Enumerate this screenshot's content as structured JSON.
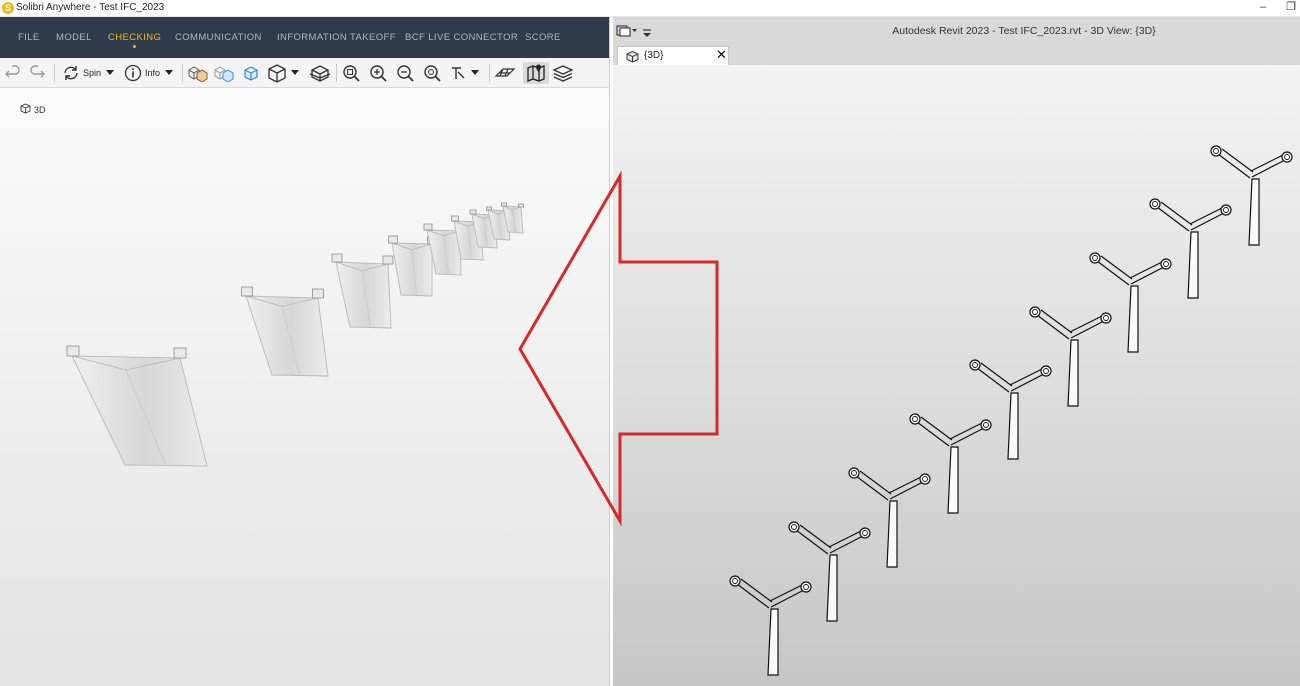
{
  "solibri": {
    "window_title": "Solibri Anywhere - Test IFC_2023",
    "logo_letter": "S",
    "menu": [
      "FILE",
      "MODEL",
      "CHECKING",
      "COMMUNICATION",
      "INFORMATION TAKEOFF",
      "BCF LIVE CONNECTOR",
      "SCORE"
    ],
    "active_menu": "CHECKING",
    "toolbar": {
      "spin_label": "Spin",
      "info_label": "Info"
    },
    "view_label": "3D"
  },
  "revit": {
    "window_title": "Autodesk Revit 2023 - Test IFC_2023.rvt - 3D View: {3D}",
    "tab_label": "{3D}",
    "tab_close": "✕"
  },
  "window_controls": {
    "minimize": "–",
    "restore": "❐"
  },
  "colors": {
    "solibri_menubar": "#2f3a4a",
    "solibri_accent": "#f2b81a",
    "arrow": "#d62a2a"
  },
  "icons": [
    "undo-icon",
    "redo-icon",
    "spin-icon",
    "info-icon",
    "cube-icon",
    "zoom-icon",
    "layers-icon",
    "map-icon",
    "close-icon"
  ]
}
